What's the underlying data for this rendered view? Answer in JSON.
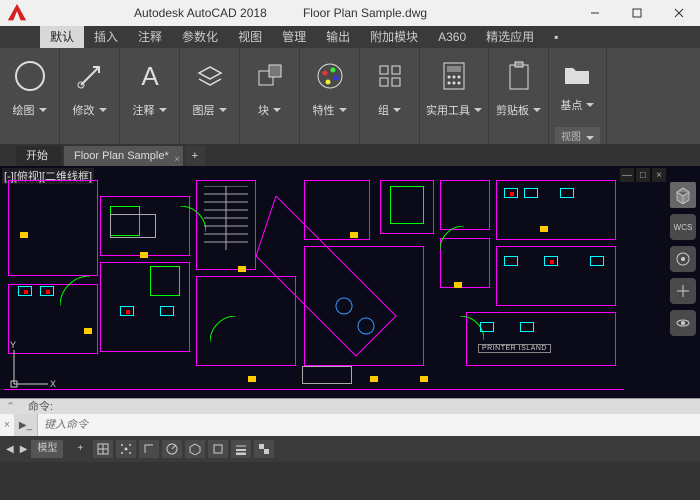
{
  "titlebar": {
    "app_title": "Autodesk AutoCAD 2018",
    "file_name": "Floor Plan Sample.dwg"
  },
  "menubar": {
    "items": [
      "默认",
      "插入",
      "注释",
      "参数化",
      "视图",
      "管理",
      "输出",
      "附加模块",
      "A360",
      "精选应用"
    ],
    "overflow": "▪"
  },
  "ribbon": {
    "panels": [
      {
        "label": "绘图"
      },
      {
        "label": "修改"
      },
      {
        "label": "注释"
      },
      {
        "label": "图层"
      },
      {
        "label": "块"
      },
      {
        "label": "特性"
      },
      {
        "label": "组"
      },
      {
        "label": "实用工具"
      },
      {
        "label": "剪贴板"
      },
      {
        "label": "基点"
      }
    ],
    "sub": "视图"
  },
  "filetabs": {
    "start": "开始",
    "active": "Floor Plan Sample*",
    "add": "+"
  },
  "viewport": {
    "label": "[-][俯视][二维线框]",
    "wcs": "WCS",
    "printer_island": "PRINTER ISLAND",
    "ucs_x": "X",
    "ucs_y": "Y"
  },
  "command": {
    "history": "命令:",
    "prompt_icon": "▶_",
    "placeholder": "键入命令"
  },
  "statusbar": {
    "layout": "模型"
  }
}
